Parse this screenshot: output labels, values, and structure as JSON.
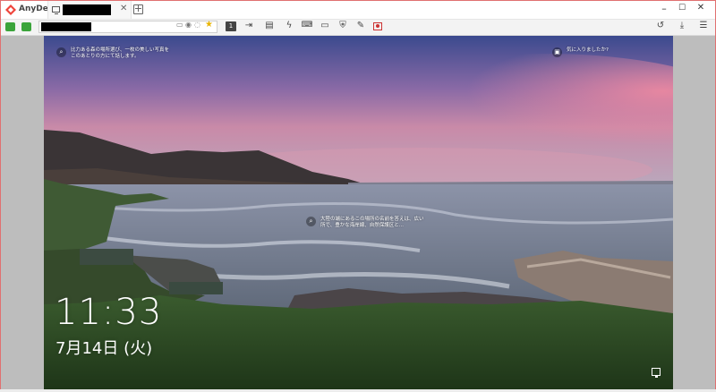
{
  "app": {
    "title": "AnyDesk",
    "accent": "#ef443b"
  },
  "tab": {
    "redacted": true
  },
  "window_controls": {
    "minimize": "–",
    "maximize": "☐",
    "close": "✕"
  },
  "toolbar": {
    "display_label": "1",
    "address_redacted": true
  },
  "lockscreen": {
    "spotlight_top_left": "比力ある森の場所選び、一枚の美しい写真をこのあとりの方にて話します。",
    "spotlight_like": "気に入りましたか?",
    "spotlight_center": "大陸の端にあるこの場所の名前を答えは、広い所で、豊かな海岸線、自然保護区と...",
    "time": "11:33",
    "date": "7月14日 (火)"
  },
  "colors": {
    "sky_top": "#3a4a8c",
    "sky_pink": "#d77a97",
    "sea": "#6f7a8f",
    "grass": "#2b4a24"
  }
}
